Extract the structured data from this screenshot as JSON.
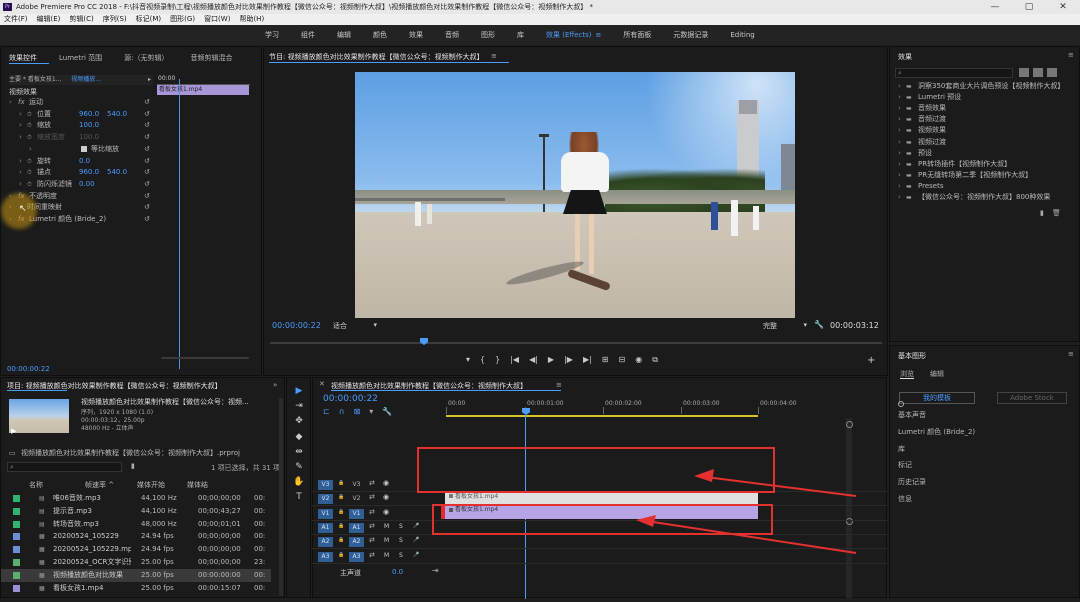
{
  "app": {
    "title": "Adobe Premiere Pro CC 2018 - F:\\抖音视频录制\\工程\\视频播放颜色对比效果制作教程【微信公众号：视频制作大叔】\\视频播放颜色对比效果制作教程【微信公众号：视频制作大叔】 *",
    "logo": "Pr"
  },
  "window": {
    "min": "—",
    "max": "▢",
    "close": "✕"
  },
  "menu": [
    "文件(F)",
    "编辑(E)",
    "剪辑(C)",
    "序列(S)",
    "标记(M)",
    "图形(G)",
    "窗口(W)",
    "帮助(H)"
  ],
  "workspaces": [
    "学习",
    "组件",
    "编辑",
    "颜色",
    "效果",
    "音频",
    "图形",
    "库",
    "效果 (Effects)",
    "所有面板",
    "元数据记录",
    "Editing"
  ],
  "workspace_active": "效果 (Effects)",
  "effect_controls": {
    "tabs": [
      "效果控件",
      "Lumetri 范围",
      "源:（无剪辑）",
      "音频剪辑混合"
    ],
    "master": "主要 * 看板女孩1...",
    "clip": "视频播放...",
    "clip_bar": "看板女孩1.mp4",
    "timecode_top": "00:00",
    "section": "视频效果",
    "rows": [
      {
        "label": "运动",
        "fx": "fx",
        "indent": 0
      },
      {
        "label": "位置",
        "v1": "960.0",
        "v2": "540.0",
        "indent": 1
      },
      {
        "label": "缩放",
        "v1": "100.0",
        "indent": 1
      },
      {
        "label": "缩放宽度",
        "v1": "100.0",
        "indent": 1,
        "dim": true
      },
      {
        "label": "等比缩放",
        "check": true,
        "indent": 2
      },
      {
        "label": "旋转",
        "v1": "0.0",
        "indent": 1
      },
      {
        "label": "锚点",
        "v1": "960.0",
        "v2": "540.0",
        "indent": 1
      },
      {
        "label": "防闪烁滤镜",
        "v1": "0.00",
        "indent": 1
      },
      {
        "label": "不透明度",
        "fx": "fx",
        "indent": 0
      },
      {
        "label": "时间重映射",
        "indent": 0
      },
      {
        "label": "Lumetri 颜色 (Bride_2)",
        "fx": "fx",
        "indent": 0
      }
    ],
    "timecode": "00:00:00:22"
  },
  "program": {
    "tab": "节目: 视频播放颜色对比效果制作教程【微信公众号：视频制作大叔】",
    "timecode": "00:00:00:22",
    "fit": "适合",
    "quality": "完整",
    "duration": "00:00:03:12",
    "controls": [
      "▾",
      "{",
      "}",
      "|◀",
      "◀|",
      "▶",
      "|▶",
      "▶|",
      "⊞",
      "⊟",
      "◉",
      "⧉"
    ],
    "add": "+"
  },
  "effects": {
    "title": "效果",
    "items": [
      "洞察350套商业大片调色预设【视频制作大叔】",
      "Lumetri 预设",
      "音频效果",
      "音频过渡",
      "视频效果",
      "视频过渡",
      "预设",
      "PR转场插件【视频制作大叔】",
      "PR无缝转场第二季【视频制作大叔】",
      "Presets",
      "【微信公众号：视频制作大叔】800种效果"
    ]
  },
  "essential": {
    "title": "基本图形",
    "tabs": [
      "浏览",
      "编辑"
    ],
    "my_templates": "我的模板",
    "adobe_stock": "Adobe Stock",
    "items": [
      "基本声音",
      "Lumetri 颜色 (Bride_2)",
      "库",
      "标记",
      "历史记录",
      "信息"
    ]
  },
  "project": {
    "tab": "项目: 视频播放颜色对比效果制作教程【微信公众号：视频制作大叔】",
    "name": "视频播放颜色对比效果制作教程【微信公众号：视频...",
    "seq": "序列，1920 x 1080 (1.0)",
    "dur": "00:00:03:12，25.00p",
    "audio": "48000 Hz - 立体声",
    "proj_file": "视频播放颜色对比效果制作教程【微信公众号：视频制作大叔】.prproj",
    "selection": "1 项已选择，共 31 项",
    "headers": [
      "名称",
      "帧速率 ^",
      "媒体开始",
      "媒体结"
    ],
    "rows": [
      {
        "color": "#2fb36f",
        "name": "唯06音效.mp3",
        "fps": "44,100 Hz",
        "start": "00;00;00;00",
        "end": "00:"
      },
      {
        "color": "#2fb36f",
        "name": "提示音.mp3",
        "fps": "44,100 Hz",
        "start": "00;00;43;27",
        "end": "00:"
      },
      {
        "color": "#2fb36f",
        "name": "转场音效.mp3",
        "fps": "48,000 Hz",
        "start": "00;00;01;01",
        "end": "00:"
      },
      {
        "color": "#6a8fd6",
        "name": "20200524_105229",
        "fps": "24.94 fps",
        "start": "00;00;00;00",
        "end": "00:"
      },
      {
        "color": "#6a8fd6",
        "name": "20200524_105229.mp4",
        "fps": "24.94 fps",
        "start": "00;00;00;00",
        "end": "00:"
      },
      {
        "color": "#5cae6e",
        "name": "20200524_OCR文字识别",
        "fps": "25.00 fps",
        "start": "00;00;00;00",
        "end": "23:"
      },
      {
        "color": "#5cae6e",
        "name": "视频播放颜色对比效果",
        "fps": "25.00 fps",
        "start": "00:00:00:00",
        "end": "00:",
        "selected": true
      },
      {
        "color": "#9c8fd6",
        "name": "看板女孩1.mp4",
        "fps": "25.00 fps",
        "start": "00:00:15:07",
        "end": "00:"
      }
    ]
  },
  "timeline": {
    "tab": "视频播放颜色对比效果制作教程【微信公众号：视频制作大叔】",
    "timecode": "00:00:00:22",
    "ruler": [
      "00:00",
      "00:00:01:00",
      "00:00:02:00",
      "00:00:03:00",
      "00:00:04:00"
    ],
    "tracks": [
      {
        "id": "V3",
        "target": "V3",
        "kind": "v"
      },
      {
        "id": "V2",
        "target": "V2",
        "kind": "v"
      },
      {
        "id": "V1",
        "target": "V1",
        "kind": "v"
      },
      {
        "id": "A1",
        "target": "A1",
        "kind": "a"
      },
      {
        "id": "A2",
        "target": "A2",
        "kind": "a"
      },
      {
        "id": "A3",
        "target": "A3",
        "kind": "a"
      }
    ],
    "master": "主声道",
    "master_val": "0.0",
    "clip_v2": "看板女孩1.mp4",
    "clip_v1": "看板女孩1.mp4"
  },
  "tools": [
    "▶",
    "⇥",
    "✥",
    "◆",
    "⇹",
    "✎",
    "✋",
    "T"
  ],
  "colors": {
    "accent": "#4a9cff",
    "annotation": "#e53030",
    "clip": "#b7a4e6"
  }
}
